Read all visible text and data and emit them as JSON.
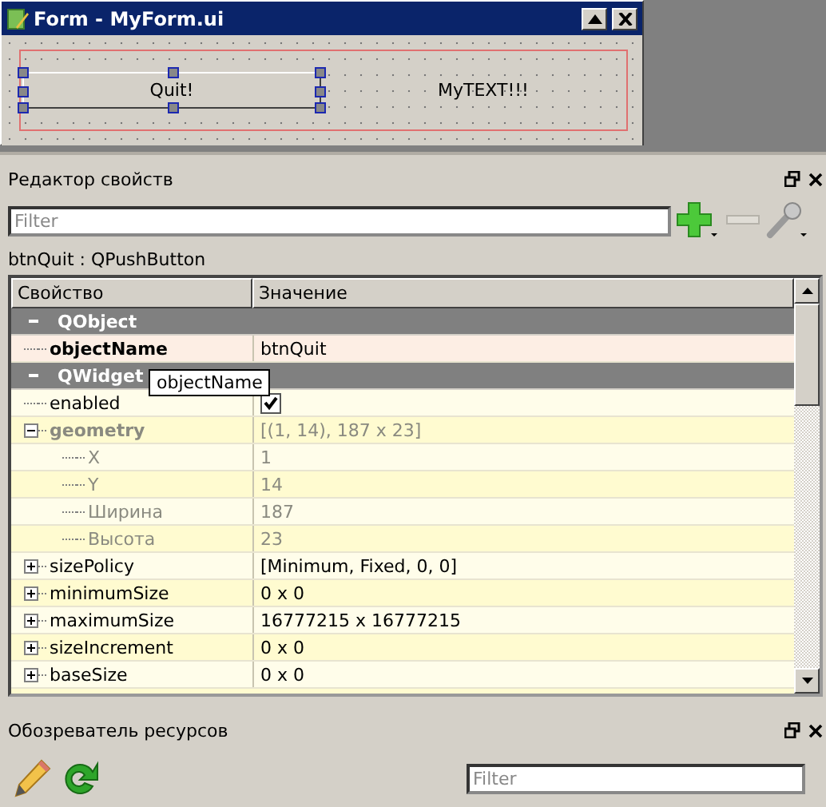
{
  "form_window": {
    "title": "Form - MyForm.ui",
    "canvas": {
      "button": {
        "label": "Quit!",
        "selected": true
      },
      "label": "MyTEXT!!!"
    }
  },
  "property_editor": {
    "title": "Редактор свойств",
    "filter": {
      "placeholder": "Filter"
    },
    "object_label": "btnQuit : QPushButton",
    "table": {
      "columns": [
        "Свойство",
        "Значение"
      ],
      "groups": [
        {
          "name": "QObject",
          "expanded": true,
          "color": "#fdeee4",
          "children": [
            {
              "name": "objectName",
              "value": "btnQuit",
              "kind": "text",
              "bold": true,
              "disabled": false
            }
          ]
        },
        {
          "name": "QWidget",
          "expanded": true,
          "color": "#fffbd0",
          "children": [
            {
              "name": "enabled",
              "kind": "checkbox",
              "checked": true,
              "bold": false,
              "disabled": false
            },
            {
              "name": "geometry",
              "value": "[(1, 14), 187 x 23]",
              "kind": "text",
              "bold": true,
              "disabled": true,
              "expanded": true,
              "children": [
                {
                  "name": "X",
                  "value": "1",
                  "kind": "text",
                  "bold": false,
                  "disabled": true
                },
                {
                  "name": "Y",
                  "value": "14",
                  "kind": "text",
                  "bold": false,
                  "disabled": true
                },
                {
                  "name": "Ширина",
                  "value": "187",
                  "kind": "text",
                  "bold": false,
                  "disabled": true
                },
                {
                  "name": "Высота",
                  "value": "23",
                  "kind": "text",
                  "bold": false,
                  "disabled": true
                }
              ]
            },
            {
              "name": "sizePolicy",
              "value": "[Minimum, Fixed, 0, 0]",
              "kind": "text",
              "bold": false,
              "disabled": false,
              "expanded": false
            },
            {
              "name": "minimumSize",
              "value": "0 x 0",
              "kind": "text",
              "bold": false,
              "disabled": false,
              "expanded": false
            },
            {
              "name": "maximumSize",
              "value": "16777215 x 16777215",
              "kind": "text",
              "bold": false,
              "disabled": false,
              "expanded": false
            },
            {
              "name": "sizeIncrement",
              "value": "0 x 0",
              "kind": "text",
              "bold": false,
              "disabled": false,
              "expanded": false
            },
            {
              "name": "baseSize",
              "value": "0 x 0",
              "kind": "text",
              "bold": false,
              "disabled": false,
              "expanded": false
            }
          ]
        }
      ]
    },
    "tooltip": "objectName"
  },
  "resource_browser": {
    "title": "Обозреватель ресурсов",
    "filter": {
      "placeholder": "Filter"
    }
  }
}
